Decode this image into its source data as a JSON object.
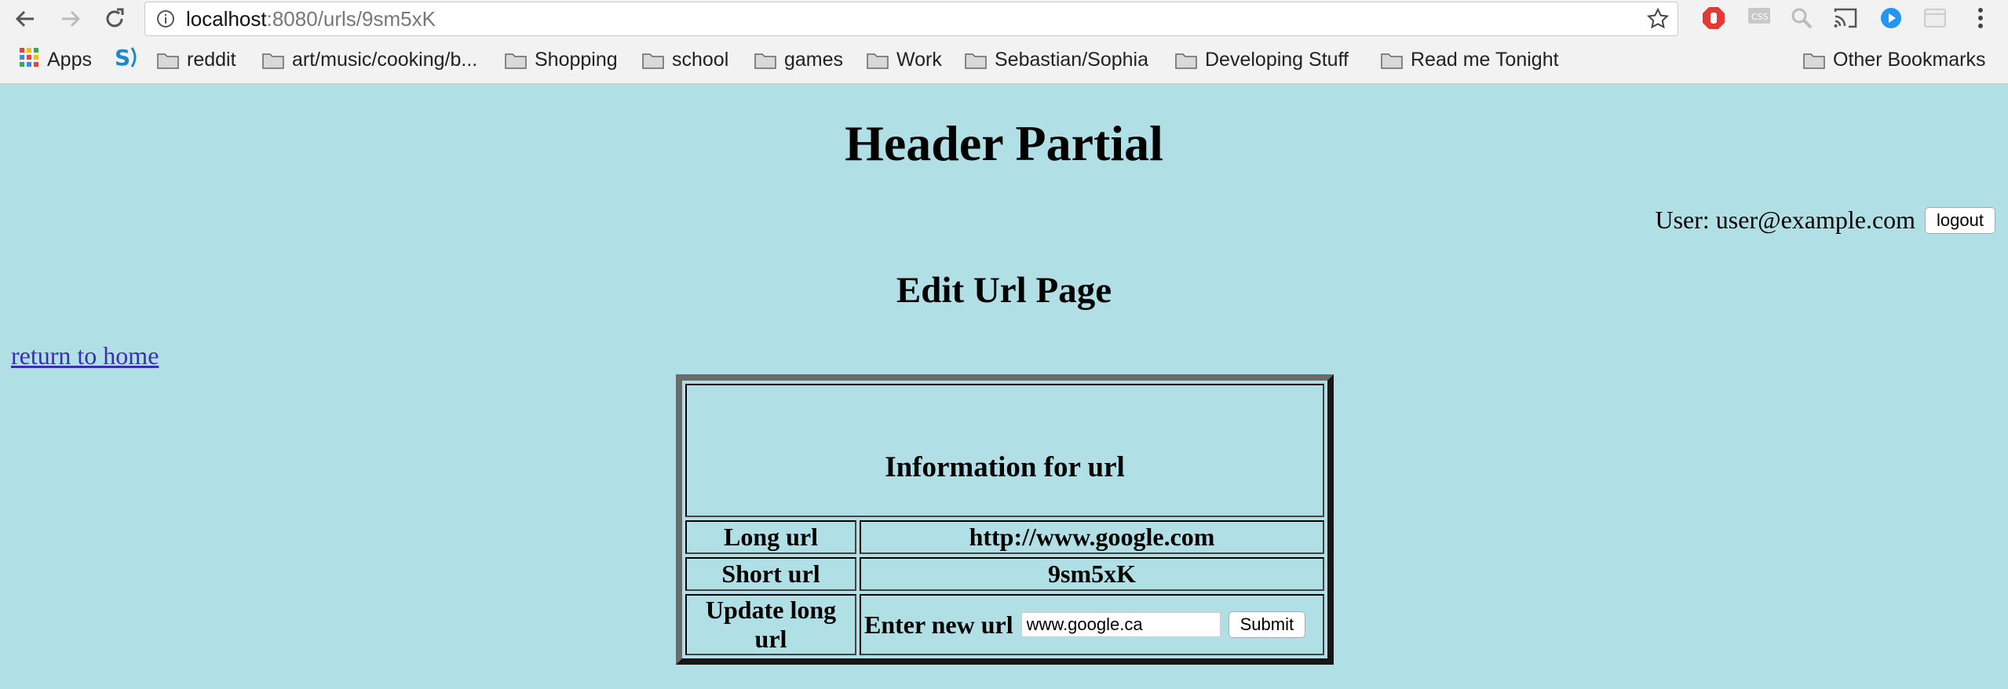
{
  "browser": {
    "url_host": "localhost",
    "url_path": ":8080/urls/9sm5xK",
    "bookmarks": [
      {
        "label": "Apps",
        "icon": "apps-grid-icon"
      },
      {
        "label": "",
        "icon": "s-logo-icon"
      },
      {
        "label": "reddit",
        "icon": "folder-icon"
      },
      {
        "label": "art/music/cooking/b...",
        "icon": "folder-icon"
      },
      {
        "label": "Shopping",
        "icon": "folder-icon"
      },
      {
        "label": "school",
        "icon": "folder-icon"
      },
      {
        "label": "games",
        "icon": "folder-icon"
      },
      {
        "label": "Work",
        "icon": "folder-icon"
      },
      {
        "label": "Sebastian/Sophia",
        "icon": "folder-icon"
      },
      {
        "label": "Developing Stuff",
        "icon": "folder-icon"
      },
      {
        "label": "Read me Tonight",
        "icon": "folder-icon"
      },
      {
        "label": "Other Bookmarks",
        "icon": "folder-icon"
      }
    ]
  },
  "header": {
    "title": "Header Partial",
    "user_label": "User: user@example.com",
    "logout_label": "logout"
  },
  "main": {
    "title": "Edit Url Page",
    "home_link": "return to home",
    "table": {
      "caption": "Information for url",
      "long_url_label": "Long url",
      "long_url_value": "http://www.google.com",
      "short_url_label": "Short url",
      "short_url_value": "9sm5xK",
      "update_label": "Update long url",
      "enter_label": "Enter new url",
      "input_value": "www.google.ca",
      "submit_label": "Submit"
    }
  },
  "colors": {
    "page_bg": "#b0e0e6",
    "link": "#3b2db5"
  }
}
